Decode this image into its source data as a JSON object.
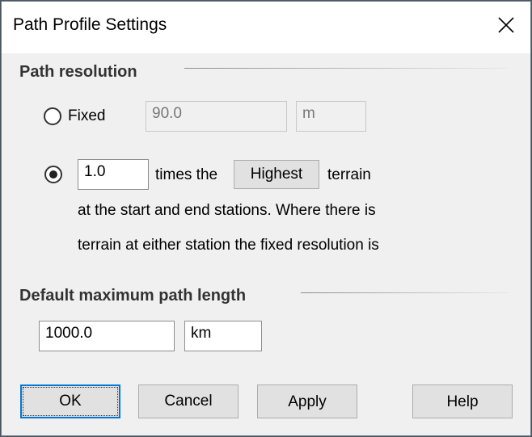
{
  "window": {
    "title": "Path Profile Settings",
    "close_icon": "close-icon"
  },
  "path_resolution": {
    "heading": "Path resolution",
    "fixed": {
      "label": "Fixed",
      "selected": false,
      "value": "90.0",
      "unit": "m"
    },
    "relative": {
      "selected": true,
      "multiplier": "1.0",
      "text_before": "times the",
      "mode_button": "Highest",
      "text_after": "terrain",
      "line2": "at the start and end stations.  Where there is",
      "line3": "terrain at either station the fixed resolution is"
    }
  },
  "max_path_length": {
    "heading": "Default maximum path length",
    "value": "1000.0",
    "unit": "km"
  },
  "buttons": {
    "ok": "OK",
    "cancel": "Cancel",
    "apply": "Apply",
    "help": "Help"
  }
}
